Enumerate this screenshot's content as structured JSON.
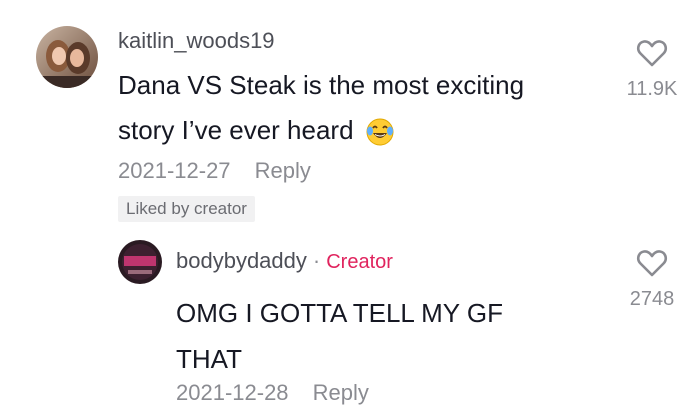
{
  "comments": [
    {
      "username": "kaitlin_woods19",
      "text_line1": "Dana VS Steak is the most exciting",
      "text_line2": "story I’ve ever heard",
      "emoji": "laughing-with-tears-emoji",
      "date": "2021-12-27",
      "reply_label": "Reply",
      "likes": "11.9K",
      "liked_by_creator": "Liked by creator"
    },
    {
      "username": "bodybydaddy",
      "separator": "·",
      "creator_label": "Creator",
      "text_line1": "OMG I GOTTA TELL MY GF",
      "text_line2": "THAT",
      "date": "2021-12-28",
      "reply_label": "Reply",
      "likes": "2748"
    }
  ],
  "icons": {
    "like": "heart-outline-icon"
  },
  "colors": {
    "creator": "#e0245e",
    "secondary_text": "#8a8b91"
  }
}
